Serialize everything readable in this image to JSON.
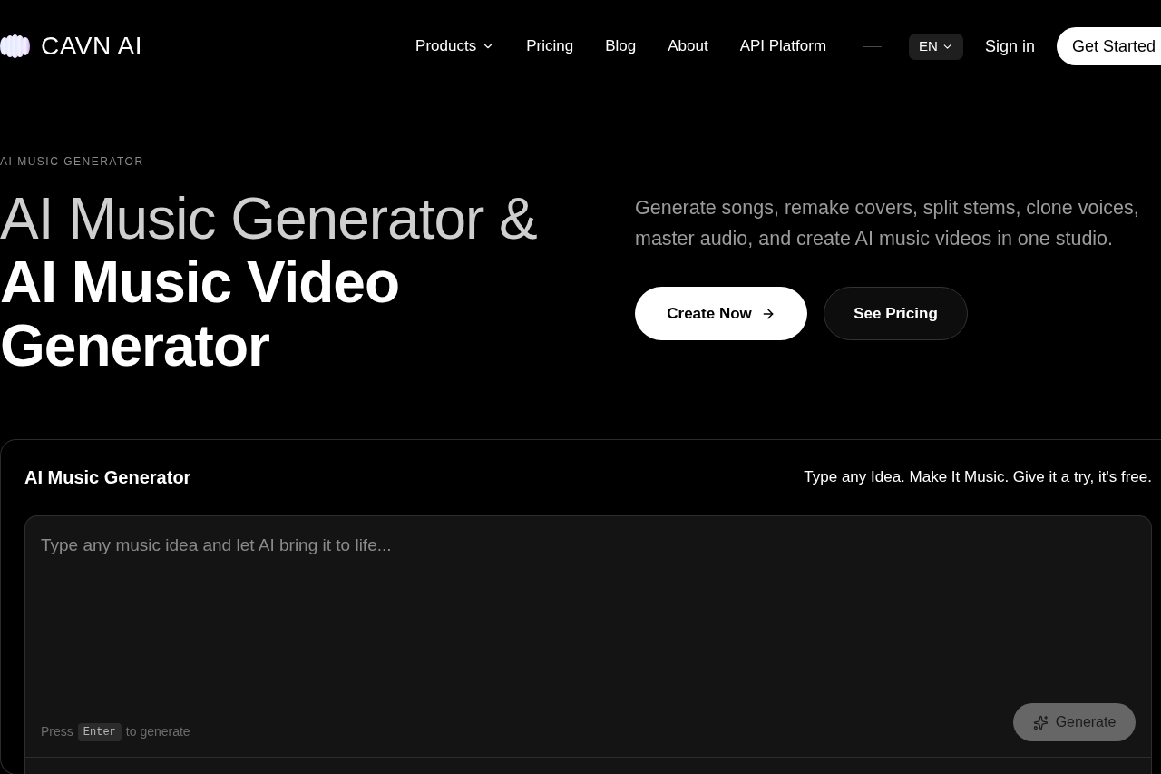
{
  "nav": {
    "brand": "CAVN AI",
    "links": [
      {
        "label": "Products",
        "kind": "dropdown"
      },
      {
        "label": "Pricing",
        "kind": "link"
      },
      {
        "label": "Blog",
        "kind": "link"
      },
      {
        "label": "About",
        "kind": "link"
      },
      {
        "label": "API Platform",
        "kind": "link"
      }
    ],
    "language": "EN",
    "sign_in": "Sign in",
    "cta": "Get Started"
  },
  "hero": {
    "eyebrow": "AI MUSIC GENERATOR",
    "title_light": "AI Music Generator &",
    "title_bold": "AI Music Video Generator",
    "description": "Generate songs, remake covers, split stems, clone voices, master audio, and create AI music videos in one studio.",
    "buttons": [
      {
        "label": "Create Now",
        "kind": "primary"
      },
      {
        "label": "See Pricing",
        "kind": "secondary"
      }
    ]
  },
  "generator": {
    "title": "AI Music Generator",
    "tagline": "Type any Idea. Make It Music. Give it a try, it's free.",
    "prompt": {
      "placeholder": "Type any music idea and let AI bring it to life..."
    },
    "hint": {
      "before": "Press",
      "key": "Enter",
      "after": "to generate"
    },
    "generate_button": {
      "label": "Generate",
      "disabled": true
    }
  }
}
